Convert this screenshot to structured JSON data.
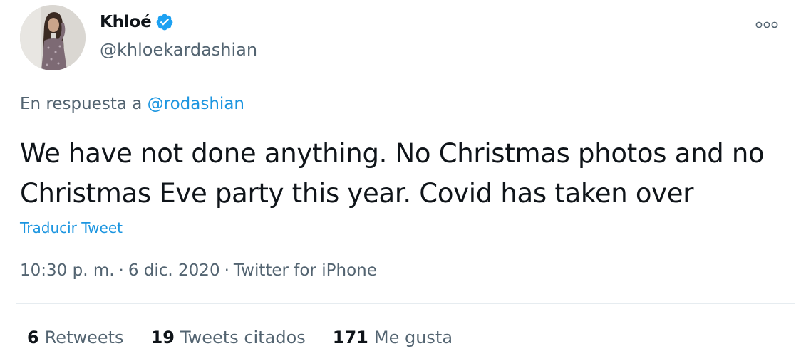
{
  "author": {
    "display_name": "Khloé",
    "handle": "@khloekardashian"
  },
  "reply": {
    "prefix": "En respuesta a",
    "mention": "@rodashian"
  },
  "tweet": {
    "text": "We have not done anything. No Christmas photos and no Christmas Eve party this year. Covid has taken over",
    "translate_label": "Traducir Tweet"
  },
  "meta": {
    "time": "10:30 p. m.",
    "date": "6 dic. 2020",
    "source": "Twitter for iPhone",
    "separator": "·"
  },
  "stats": {
    "retweets_count": "6",
    "retweets_label": "Retweets",
    "quotes_count": "19",
    "quotes_label": "Tweets citados",
    "likes_count": "171",
    "likes_label": "Me gusta"
  },
  "colors": {
    "accent": "#1b95e0",
    "secondary_text": "#536471",
    "primary_text": "#0f1419",
    "verified": "#1da1f2"
  },
  "icons": {
    "verified": "verified-badge-icon",
    "more": "more-options-icon"
  }
}
